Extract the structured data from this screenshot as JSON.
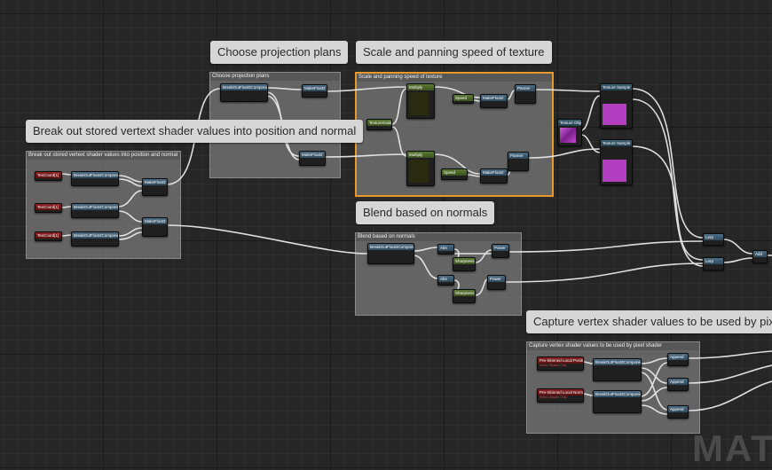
{
  "comments": [
    {
      "id": "c1",
      "title": "Break out stored vertext shader values into position and normal",
      "bubble": "Break out stored vertext shader values into position and normal"
    },
    {
      "id": "c2",
      "title": "Choose projection plans",
      "bubble": "Choose projection plans"
    },
    {
      "id": "c3",
      "title": "Scale and panning speed of texture",
      "bubble": "Scale and panning speed of texture"
    },
    {
      "id": "c4",
      "title": "Blend based on normals",
      "bubble": "Blend based on normals"
    },
    {
      "id": "c5",
      "title": "Capture vertex shader values to be used by pixel shader",
      "bubble": "Capture vertex shader values to be used by pix"
    }
  ],
  "nodes": {
    "tex_coord": "TexCoord[1]",
    "break_float4": "BreakOutFloat4Components",
    "break_float3": "BreakOutFloat3Components",
    "make_float2": "MakeFloat2",
    "make_float3": "MakeFloat3",
    "multiply": "Multiply",
    "speed": "Speed",
    "panner": "Panner",
    "texture_sample": "Texture Sample",
    "texture_object": "Texture Object",
    "texture_scale": "TextureScale",
    "lerp": "Lerp",
    "add": "Add",
    "abs": "Abs",
    "power": "Power",
    "sharpness": "Sharpness",
    "append": "Append",
    "pre_skinned_position": "Pre-Skinned Local Position",
    "pre_skinned_normal": "Pre-Skinned Local Normal",
    "vertex_shader_only": "Vertex Shader Only"
  },
  "colors": {
    "background": "#262626",
    "comment_fill": "#7d7d7d",
    "selected_border": "#e79a2a",
    "wire": "#e8e8e8",
    "texture_swatch": "#b13fc0"
  },
  "watermark": "MAT"
}
